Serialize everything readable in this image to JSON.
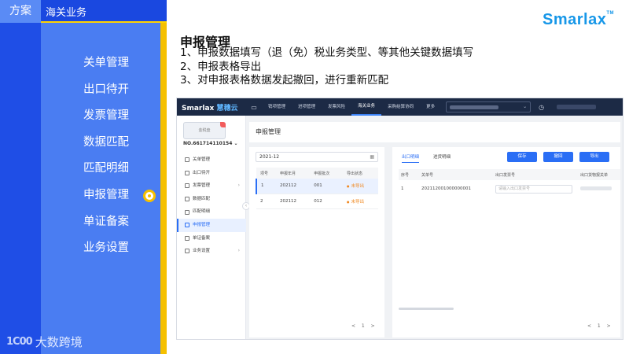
{
  "header": {
    "tab_fangan": "方案",
    "tab_haiguan": "海关业务"
  },
  "nav": {
    "items": [
      {
        "label": "关单管理"
      },
      {
        "label": "出口待开"
      },
      {
        "label": "发票管理"
      },
      {
        "label": "数据匹配"
      },
      {
        "label": "匹配明细"
      },
      {
        "label": "申报管理",
        "active": true
      },
      {
        "label": "单证备案"
      },
      {
        "label": "业务设置"
      }
    ]
  },
  "footer_logo": {
    "mark": "1C00",
    "text": "大数跨境"
  },
  "brand_logo": "Smarlax",
  "slide": {
    "title": "申报管理",
    "points": [
      "1、申报数据填写（退（免）税业务类型、等其他关键数据填写",
      "2、申报表格导出",
      "3、对申报表格数据发起撤回，进行重新匹配"
    ]
  },
  "app": {
    "brand": "Smarlax",
    "brand_suffix": "慧穗云",
    "menu": [
      "销项管理",
      "进项管理",
      "发票风险",
      "海关业务",
      "采购结算协同",
      "更多"
    ],
    "active_menu": "海关业务",
    "card_label": "金税盘",
    "company_no": "NO.661714110154",
    "side_menu": [
      {
        "label": "关单管理",
        "icon": "document-icon",
        "chevron": false
      },
      {
        "label": "出口待开",
        "icon": "export-icon",
        "chevron": false
      },
      {
        "label": "发票管理",
        "icon": "invoice-icon",
        "chevron": true
      },
      {
        "label": "数据匹配",
        "icon": "match-icon",
        "chevron": false
      },
      {
        "label": "匹配明细",
        "icon": "list-icon",
        "chevron": false
      },
      {
        "label": "申报管理",
        "icon": "declare-icon",
        "chevron": false,
        "active": true
      },
      {
        "label": "单证备案",
        "icon": "file-icon",
        "chevron": false
      },
      {
        "label": "业务设置",
        "icon": "settings-icon",
        "chevron": true
      }
    ],
    "page_title": "申报管理",
    "left_panel": {
      "date_value": "2021-12",
      "columns": [
        "项号",
        "申报年月",
        "申报批次",
        "导出状态"
      ],
      "rows": [
        {
          "no": "1",
          "period": "202112",
          "batch": "001",
          "status": "未导出"
        },
        {
          "no": "2",
          "period": "202112",
          "batch": "012",
          "status": "未导出"
        }
      ],
      "pager": "< 1 >"
    },
    "right_panel": {
      "tabs": [
        "出口明细",
        "进货明细"
      ],
      "active_tab": "出口明细",
      "buttons": [
        "保存",
        "撤回",
        "导出"
      ],
      "columns": [
        "序号",
        "关单号",
        "出口发票号",
        "出口货物报关单"
      ],
      "rows": [
        {
          "no": "1",
          "customs_no": "202112001000000001",
          "invoice_placeholder": "请输入出口发票号"
        }
      ],
      "pager": "< 1 >"
    }
  }
}
